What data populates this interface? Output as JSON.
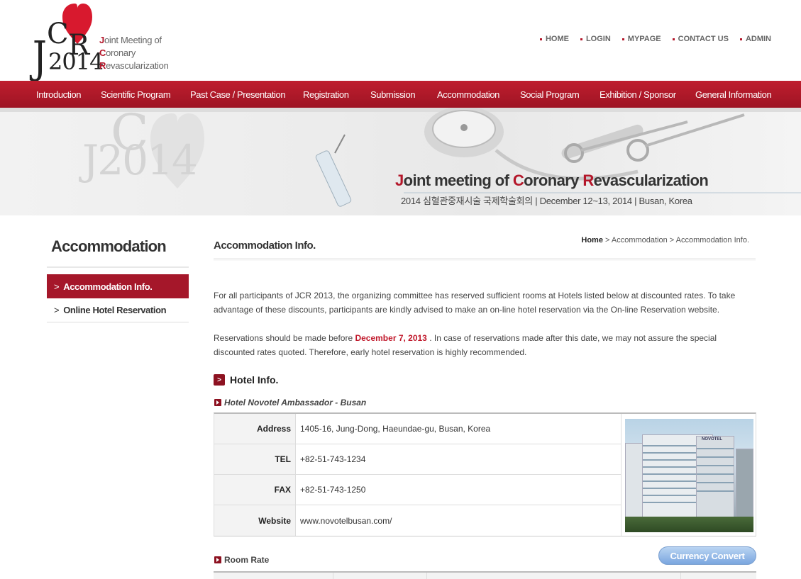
{
  "logo": {
    "mark_j": "J",
    "mark_c": "C",
    "mark_r": "R",
    "mark_year": "2014",
    "line1_initial": "J",
    "line1_rest": "oint Meeting of",
    "line2_initial": "C",
    "line2_rest": "oronary",
    "line3_initial": "R",
    "line3_rest": "evascularization"
  },
  "topnav": [
    "HOME",
    "LOGIN",
    "MYPAGE",
    "CONTACT US",
    "ADMIN"
  ],
  "mainnav": [
    "Introduction",
    "Scientific Program",
    "Past Case / Presentation",
    "Registration",
    "Submission",
    "Accommodation",
    "Social Program",
    "Exhibition / Sponsor",
    "General Information"
  ],
  "banner": {
    "bg_mark": "J2014",
    "bg_mark_c": "C",
    "title_j": "J",
    "title_1": "oint meeting of ",
    "title_c": "C",
    "title_2": "oronary ",
    "title_r": "R",
    "title_3": "evascularization",
    "subtitle": "2014 심혈관중재시술 국제학술회의 | December 12~13, 2014   | Busan, Korea"
  },
  "sidebar": {
    "title": "Accommodation",
    "items": [
      {
        "chev": ">",
        "label": "Accommodation Info."
      },
      {
        "chev": ">",
        "label": "Online Hotel Reservation"
      }
    ]
  },
  "content": {
    "title": "Accommodation Info.",
    "breadcrumb_home": "Home",
    "breadcrumb_rest": " > Accommodation > Accommodation Info.",
    "para1": "For all participants of JCR 2013, the organizing committee has reserved sufficient rooms at Hotels listed below at discounted rates. To take advantage of these discounts, participants are kindly advised to make an on-line hotel reservation via the On-line Reservation website.",
    "para2_before": "Reservations should be made before ",
    "para2_date": "December 7, 2013",
    "para2_after": " . In case of reservations made after this date, we may not assure the special discounted rates quoted. Therefore, early hotel reservation is highly recommended.",
    "section_title": "Hotel Info.",
    "section_icon": ">",
    "hotel_name": "Hotel Novotel Ambassador - Busan",
    "hotel_rows": [
      {
        "label": "Address",
        "value": "1405-16, Jung-Dong, Haeundae-gu, Busan, Korea"
      },
      {
        "label": "TEL",
        "value": "+82-51-743-1234"
      },
      {
        "label": "FAX",
        "value": "+82-51-743-1250"
      },
      {
        "label": "Website",
        "value": "www.novotelbusan.com/"
      }
    ],
    "photo_sign": "NOVOTEL",
    "room_rate_title": "Room Rate",
    "currency_button": "Currency Convert"
  },
  "colors": {
    "brand_red": "#b4172a",
    "nav_red": "#a5172a",
    "button_blue": "#7aa6df"
  }
}
